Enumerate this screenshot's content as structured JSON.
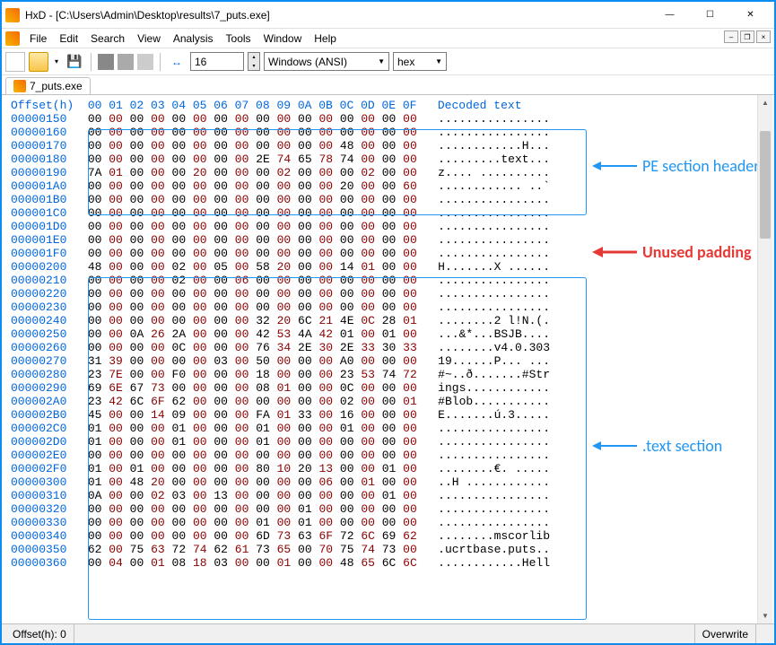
{
  "window": {
    "title": "HxD - [C:\\Users\\Admin\\Desktop\\results\\7_puts.exe]"
  },
  "menus": [
    "File",
    "Edit",
    "Search",
    "View",
    "Analysis",
    "Tools",
    "Window",
    "Help"
  ],
  "toolbar": {
    "bytesPerRow": "16",
    "encoding": "Windows (ANSI)",
    "base": "hex"
  },
  "tab": {
    "name": "7_puts.exe"
  },
  "hex": {
    "headerLabel": "Offset(h)",
    "columns": [
      "00",
      "01",
      "02",
      "03",
      "04",
      "05",
      "06",
      "07",
      "08",
      "09",
      "0A",
      "0B",
      "0C",
      "0D",
      "0E",
      "0F"
    ],
    "decodedHeader": "Decoded text",
    "rows": [
      {
        "o": "00000150",
        "b": [
          "00",
          "00",
          "00",
          "00",
          "00",
          "00",
          "00",
          "00",
          "00",
          "00",
          "00",
          "00",
          "00",
          "00",
          "00",
          "00"
        ],
        "t": "................"
      },
      {
        "o": "00000160",
        "b": [
          "00",
          "00",
          "00",
          "00",
          "00",
          "00",
          "00",
          "00",
          "00",
          "00",
          "00",
          "00",
          "00",
          "00",
          "00",
          "00"
        ],
        "t": "................"
      },
      {
        "o": "00000170",
        "b": [
          "00",
          "00",
          "00",
          "00",
          "00",
          "00",
          "00",
          "00",
          "00",
          "00",
          "00",
          "00",
          "48",
          "00",
          "00",
          "00"
        ],
        "t": "............H..."
      },
      {
        "o": "00000180",
        "b": [
          "00",
          "00",
          "00",
          "00",
          "00",
          "00",
          "00",
          "00",
          "2E",
          "74",
          "65",
          "78",
          "74",
          "00",
          "00",
          "00"
        ],
        "t": ".........text..."
      },
      {
        "o": "00000190",
        "b": [
          "7A",
          "01",
          "00",
          "00",
          "00",
          "20",
          "00",
          "00",
          "00",
          "02",
          "00",
          "00",
          "00",
          "02",
          "00",
          "00"
        ],
        "t": "z.... .........."
      },
      {
        "o": "000001A0",
        "b": [
          "00",
          "00",
          "00",
          "00",
          "00",
          "00",
          "00",
          "00",
          "00",
          "00",
          "00",
          "00",
          "20",
          "00",
          "00",
          "60"
        ],
        "t": "............ ..`"
      },
      {
        "o": "000001B0",
        "b": [
          "00",
          "00",
          "00",
          "00",
          "00",
          "00",
          "00",
          "00",
          "00",
          "00",
          "00",
          "00",
          "00",
          "00",
          "00",
          "00"
        ],
        "t": "................"
      },
      {
        "o": "000001C0",
        "b": [
          "00",
          "00",
          "00",
          "00",
          "00",
          "00",
          "00",
          "00",
          "00",
          "00",
          "00",
          "00",
          "00",
          "00",
          "00",
          "00"
        ],
        "t": "................"
      },
      {
        "o": "000001D0",
        "b": [
          "00",
          "00",
          "00",
          "00",
          "00",
          "00",
          "00",
          "00",
          "00",
          "00",
          "00",
          "00",
          "00",
          "00",
          "00",
          "00"
        ],
        "t": "................"
      },
      {
        "o": "000001E0",
        "b": [
          "00",
          "00",
          "00",
          "00",
          "00",
          "00",
          "00",
          "00",
          "00",
          "00",
          "00",
          "00",
          "00",
          "00",
          "00",
          "00"
        ],
        "t": "................"
      },
      {
        "o": "000001F0",
        "b": [
          "00",
          "00",
          "00",
          "00",
          "00",
          "00",
          "00",
          "00",
          "00",
          "00",
          "00",
          "00",
          "00",
          "00",
          "00",
          "00"
        ],
        "t": "................"
      },
      {
        "o": "00000200",
        "b": [
          "48",
          "00",
          "00",
          "00",
          "02",
          "00",
          "05",
          "00",
          "58",
          "20",
          "00",
          "00",
          "14",
          "01",
          "00",
          "00"
        ],
        "t": "H.......X ......"
      },
      {
        "o": "00000210",
        "b": [
          "00",
          "00",
          "00",
          "00",
          "02",
          "00",
          "00",
          "06",
          "00",
          "00",
          "00",
          "00",
          "00",
          "00",
          "00",
          "00"
        ],
        "t": "................"
      },
      {
        "o": "00000220",
        "b": [
          "00",
          "00",
          "00",
          "00",
          "00",
          "00",
          "00",
          "00",
          "00",
          "00",
          "00",
          "00",
          "00",
          "00",
          "00",
          "00"
        ],
        "t": "................"
      },
      {
        "o": "00000230",
        "b": [
          "00",
          "00",
          "00",
          "00",
          "00",
          "00",
          "00",
          "00",
          "00",
          "00",
          "00",
          "00",
          "00",
          "00",
          "00",
          "00"
        ],
        "t": "................"
      },
      {
        "o": "00000240",
        "b": [
          "00",
          "00",
          "00",
          "00",
          "00",
          "00",
          "00",
          "00",
          "32",
          "20",
          "6C",
          "21",
          "4E",
          "0C",
          "28",
          "01"
        ],
        "t": "........2 l!N.(."
      },
      {
        "o": "00000250",
        "b": [
          "00",
          "00",
          "0A",
          "26",
          "2A",
          "00",
          "00",
          "00",
          "42",
          "53",
          "4A",
          "42",
          "01",
          "00",
          "01",
          "00"
        ],
        "t": "...&*...BSJB...."
      },
      {
        "o": "00000260",
        "b": [
          "00",
          "00",
          "00",
          "00",
          "0C",
          "00",
          "00",
          "00",
          "76",
          "34",
          "2E",
          "30",
          "2E",
          "33",
          "30",
          "33"
        ],
        "t": "........v4.0.303"
      },
      {
        "o": "00000270",
        "b": [
          "31",
          "39",
          "00",
          "00",
          "00",
          "00",
          "03",
          "00",
          "50",
          "00",
          "00",
          "00",
          "A0",
          "00",
          "00",
          "00"
        ],
        "t": "19......P... ..."
      },
      {
        "o": "00000280",
        "b": [
          "23",
          "7E",
          "00",
          "00",
          "F0",
          "00",
          "00",
          "00",
          "18",
          "00",
          "00",
          "00",
          "23",
          "53",
          "74",
          "72"
        ],
        "t": "#~..ð.......#Str"
      },
      {
        "o": "00000290",
        "b": [
          "69",
          "6E",
          "67",
          "73",
          "00",
          "00",
          "00",
          "00",
          "08",
          "01",
          "00",
          "00",
          "0C",
          "00",
          "00",
          "00"
        ],
        "t": "ings............"
      },
      {
        "o": "000002A0",
        "b": [
          "23",
          "42",
          "6C",
          "6F",
          "62",
          "00",
          "00",
          "00",
          "00",
          "00",
          "00",
          "00",
          "02",
          "00",
          "00",
          "01"
        ],
        "t": "#Blob..........."
      },
      {
        "o": "000002B0",
        "b": [
          "45",
          "00",
          "00",
          "14",
          "09",
          "00",
          "00",
          "00",
          "FA",
          "01",
          "33",
          "00",
          "16",
          "00",
          "00",
          "00"
        ],
        "t": "E.......ú.3....."
      },
      {
        "o": "000002C0",
        "b": [
          "01",
          "00",
          "00",
          "00",
          "01",
          "00",
          "00",
          "00",
          "01",
          "00",
          "00",
          "00",
          "01",
          "00",
          "00",
          "00"
        ],
        "t": "................"
      },
      {
        "o": "000002D0",
        "b": [
          "01",
          "00",
          "00",
          "00",
          "01",
          "00",
          "00",
          "00",
          "01",
          "00",
          "00",
          "00",
          "00",
          "00",
          "00",
          "00"
        ],
        "t": "................"
      },
      {
        "o": "000002E0",
        "b": [
          "00",
          "00",
          "00",
          "00",
          "00",
          "00",
          "00",
          "00",
          "00",
          "00",
          "00",
          "00",
          "00",
          "00",
          "00",
          "00"
        ],
        "t": "................"
      },
      {
        "o": "000002F0",
        "b": [
          "01",
          "00",
          "01",
          "00",
          "00",
          "00",
          "00",
          "00",
          "80",
          "10",
          "20",
          "13",
          "00",
          "00",
          "01",
          "00"
        ],
        "t": "........€. ....."
      },
      {
        "o": "00000300",
        "b": [
          "01",
          "00",
          "48",
          "20",
          "00",
          "00",
          "00",
          "00",
          "00",
          "00",
          "00",
          "06",
          "00",
          "01",
          "00",
          "00"
        ],
        "t": "..H ............"
      },
      {
        "o": "00000310",
        "b": [
          "0A",
          "00",
          "00",
          "02",
          "03",
          "00",
          "13",
          "00",
          "00",
          "00",
          "00",
          "00",
          "00",
          "00",
          "01",
          "00"
        ],
        "t": "................"
      },
      {
        "o": "00000320",
        "b": [
          "00",
          "00",
          "00",
          "00",
          "00",
          "00",
          "00",
          "00",
          "00",
          "00",
          "01",
          "00",
          "00",
          "00",
          "00",
          "00"
        ],
        "t": "................"
      },
      {
        "o": "00000330",
        "b": [
          "00",
          "00",
          "00",
          "00",
          "00",
          "00",
          "00",
          "00",
          "01",
          "00",
          "01",
          "00",
          "00",
          "00",
          "00",
          "00"
        ],
        "t": "................"
      },
      {
        "o": "00000340",
        "b": [
          "00",
          "00",
          "00",
          "00",
          "00",
          "00",
          "00",
          "00",
          "6D",
          "73",
          "63",
          "6F",
          "72",
          "6C",
          "69",
          "62"
        ],
        "t": "........mscorlib"
      },
      {
        "o": "00000350",
        "b": [
          "62",
          "00",
          "75",
          "63",
          "72",
          "74",
          "62",
          "61",
          "73",
          "65",
          "00",
          "70",
          "75",
          "74",
          "73",
          "00"
        ],
        "t": ".ucrtbase.puts.."
      },
      {
        "o": "00000360",
        "b": [
          "00",
          "04",
          "00",
          "01",
          "08",
          "18",
          "03",
          "00",
          "00",
          "01",
          "00",
          "00",
          "48",
          "65",
          "6C",
          "6C"
        ],
        "t": "............Hell"
      }
    ]
  },
  "annotations": {
    "peHeaders": "PE section headers",
    "padding": "Unused padding",
    "textSection": ".text section"
  },
  "status": {
    "offset": "Offset(h): 0",
    "mode": "Overwrite"
  }
}
